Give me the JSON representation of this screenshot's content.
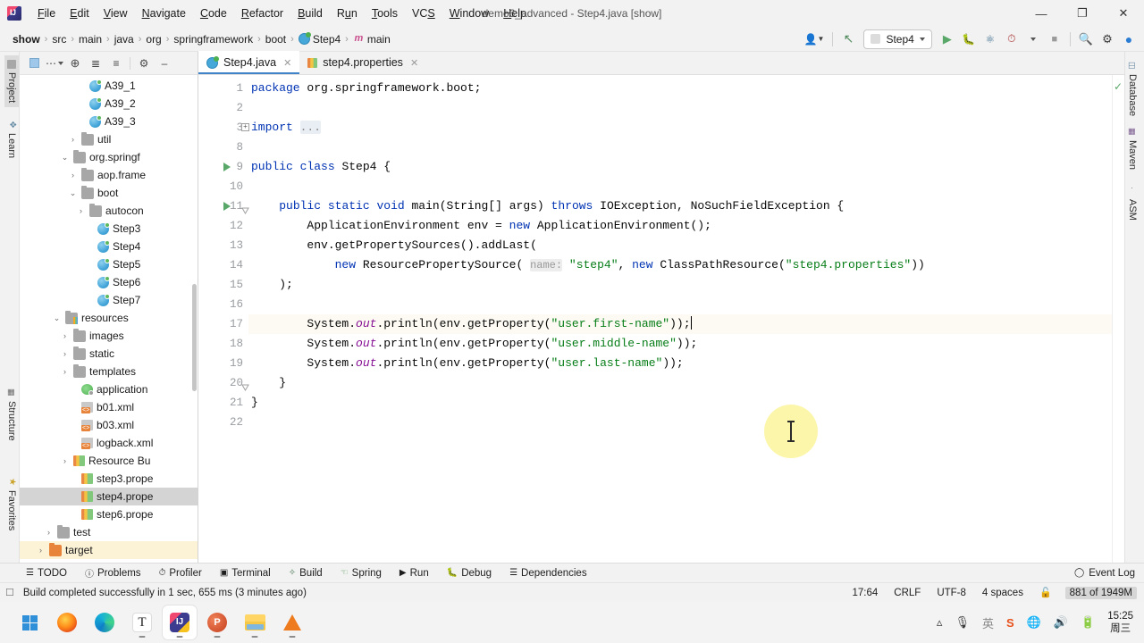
{
  "window": {
    "title": "demo6_advanced - Step4.java [show]",
    "app_icon": "intellij-idea-icon",
    "minimize": "—",
    "maximize": "❐",
    "close": "✕"
  },
  "menubar": {
    "items": [
      "File",
      "Edit",
      "View",
      "Navigate",
      "Code",
      "Refactor",
      "Build",
      "Run",
      "Tools",
      "VCS",
      "Window",
      "Help"
    ]
  },
  "breadcrumb": {
    "items": [
      {
        "label": "show",
        "icon": ""
      },
      {
        "label": "src",
        "icon": ""
      },
      {
        "label": "main",
        "icon": ""
      },
      {
        "label": "java",
        "icon": ""
      },
      {
        "label": "org",
        "icon": ""
      },
      {
        "label": "springframework",
        "icon": ""
      },
      {
        "label": "boot",
        "icon": ""
      },
      {
        "label": "Step4",
        "icon": "class-icon"
      },
      {
        "label": "main",
        "icon": "method-icon"
      }
    ],
    "separator": "›"
  },
  "toolbar": {
    "profile_label": "👤",
    "updates_label": "↖",
    "run_config": "Step4",
    "run_label": "▶",
    "debug_label": "debug-icon",
    "run_coverage_label": "run-with-coverage-icon",
    "profiler_label": "profiler-icon",
    "stop_label": "■",
    "search_label": "⌕",
    "settings_label": "⚙",
    "ai_label": "ai-assistant-icon"
  },
  "left_stripe": {
    "tabs": [
      {
        "label": "Project",
        "icon": "project-icon",
        "active": true
      },
      {
        "label": "Learn",
        "icon": "learn-icon",
        "active": false
      },
      {
        "label": "Structure",
        "icon": "structure-icon",
        "active": false
      },
      {
        "label": "Favorites",
        "icon": "star-icon",
        "active": false
      }
    ]
  },
  "right_stripe": {
    "tabs": [
      {
        "label": "Database",
        "icon": "database-icon"
      },
      {
        "label": "Maven",
        "icon": "maven-icon"
      },
      {
        "label": "ASM",
        "icon": "asm-icon"
      }
    ]
  },
  "project_panel": {
    "header_buttons": [
      {
        "name": "project-view-selector",
        "glyph": "▣"
      },
      {
        "name": "ellipsis",
        "glyph": "⋯"
      },
      {
        "name": "locate-icon",
        "glyph": "⊕"
      },
      {
        "name": "expand-all-icon",
        "glyph": "≣"
      },
      {
        "name": "collapse-all-icon",
        "glyph": "≡"
      },
      {
        "name": "gear-icon",
        "glyph": "⚙"
      },
      {
        "name": "hide-icon",
        "glyph": "—"
      }
    ],
    "tree": [
      {
        "label": "A39_1",
        "indent": 7,
        "icon": "class-icon",
        "arrow": "",
        "state": "normal"
      },
      {
        "label": "A39_2",
        "indent": 7,
        "icon": "class-icon",
        "arrow": "",
        "state": "normal"
      },
      {
        "label": "A39_3",
        "indent": 7,
        "icon": "class-icon",
        "arrow": "",
        "state": "normal"
      },
      {
        "label": "util",
        "indent": 6,
        "icon": "folder-gray",
        "arrow": "›",
        "state": "normal"
      },
      {
        "label": "org.springf",
        "indent": 5,
        "icon": "folder-gray",
        "arrow": "∨",
        "state": "normal"
      },
      {
        "label": "aop.frame",
        "indent": 6,
        "icon": "folder-gray",
        "arrow": "›",
        "state": "normal"
      },
      {
        "label": "boot",
        "indent": 6,
        "icon": "folder-gray",
        "arrow": "∨",
        "state": "normal"
      },
      {
        "label": "autocon",
        "indent": 7,
        "icon": "folder-gray",
        "arrow": "›",
        "state": "normal"
      },
      {
        "label": "Step3",
        "indent": 8,
        "icon": "class-icon",
        "arrow": "",
        "state": "normal"
      },
      {
        "label": "Step4",
        "indent": 8,
        "icon": "class-icon",
        "arrow": "",
        "state": "normal"
      },
      {
        "label": "Step5",
        "indent": 8,
        "icon": "class-icon",
        "arrow": "",
        "state": "normal"
      },
      {
        "label": "Step6",
        "indent": 8,
        "icon": "class-icon",
        "arrow": "",
        "state": "normal"
      },
      {
        "label": "Step7",
        "indent": 8,
        "icon": "class-icon",
        "arrow": "",
        "state": "normal"
      },
      {
        "label": "resources",
        "indent": 4,
        "icon": "folder-resources",
        "arrow": "∨",
        "state": "normal"
      },
      {
        "label": "images",
        "indent": 5,
        "icon": "folder-gray",
        "arrow": "›",
        "state": "normal"
      },
      {
        "label": "static",
        "indent": 5,
        "icon": "folder-gray",
        "arrow": "›",
        "state": "normal"
      },
      {
        "label": "templates",
        "indent": 5,
        "icon": "folder-gray",
        "arrow": "›",
        "state": "normal"
      },
      {
        "label": "application",
        "indent": 6,
        "icon": "yaml-icon",
        "arrow": "",
        "state": "normal"
      },
      {
        "label": "b01.xml",
        "indent": 6,
        "icon": "xml-icon",
        "arrow": "",
        "state": "normal"
      },
      {
        "label": "b03.xml",
        "indent": 6,
        "icon": "xml-icon",
        "arrow": "",
        "state": "normal"
      },
      {
        "label": "logback.xml",
        "indent": 6,
        "icon": "xml-icon",
        "arrow": "",
        "state": "normal"
      },
      {
        "label": "Resource Bu",
        "indent": 5,
        "icon": "properties-icon",
        "arrow": "›",
        "state": "normal"
      },
      {
        "label": "step3.prope",
        "indent": 6,
        "icon": "properties-icon",
        "arrow": "",
        "state": "normal"
      },
      {
        "label": "step4.prope",
        "indent": 6,
        "icon": "properties-icon",
        "arrow": "",
        "state": "selected"
      },
      {
        "label": "step6.prope",
        "indent": 6,
        "icon": "properties-icon",
        "arrow": "",
        "state": "normal"
      },
      {
        "label": "test",
        "indent": 3,
        "icon": "folder-gray",
        "arrow": "›",
        "state": "normal"
      },
      {
        "label": "target",
        "indent": 2,
        "icon": "folder-orange",
        "arrow": "›",
        "state": "target"
      }
    ]
  },
  "editor": {
    "tabs": [
      {
        "label": "Step4.java",
        "icon": "java-class-icon",
        "active": true,
        "close": "✕"
      },
      {
        "label": "step4.properties",
        "icon": "properties-icon",
        "active": false,
        "close": "✕"
      }
    ],
    "inspection_status": "✓",
    "lines": [
      {
        "num": "1",
        "run": false,
        "fold": "open",
        "hl": false
      },
      {
        "num": "2",
        "run": false,
        "fold": "",
        "hl": false
      },
      {
        "num": "3",
        "run": false,
        "fold": "box",
        "hl": false
      },
      {
        "num": "8",
        "run": false,
        "fold": "",
        "hl": false
      },
      {
        "num": "9",
        "run": true,
        "fold": "",
        "hl": false
      },
      {
        "num": "10",
        "run": false,
        "fold": "",
        "hl": false
      },
      {
        "num": "11",
        "run": true,
        "fold": "end",
        "hl": false
      },
      {
        "num": "12",
        "run": false,
        "fold": "",
        "hl": false
      },
      {
        "num": "13",
        "run": false,
        "fold": "",
        "hl": false
      },
      {
        "num": "14",
        "run": false,
        "fold": "",
        "hl": false
      },
      {
        "num": "15",
        "run": false,
        "fold": "",
        "hl": false
      },
      {
        "num": "16",
        "run": false,
        "fold": "",
        "hl": false
      },
      {
        "num": "17",
        "run": false,
        "fold": "",
        "hl": true
      },
      {
        "num": "18",
        "run": false,
        "fold": "",
        "hl": false
      },
      {
        "num": "19",
        "run": false,
        "fold": "",
        "hl": false
      },
      {
        "num": "20",
        "run": false,
        "fold": "end2",
        "hl": false
      },
      {
        "num": "21",
        "run": false,
        "fold": "",
        "hl": false
      },
      {
        "num": "22",
        "run": false,
        "fold": "",
        "hl": false
      }
    ],
    "code_text": [
      "package org.springframework.boot;",
      "",
      "import ...",
      "",
      "public class Step4 {",
      "",
      "    public static void main(String[] args) throws IOException, NoSuchFieldException {",
      "        ApplicationEnvironment env = new ApplicationEnvironment();",
      "        env.getPropertySources().addLast(",
      "            new ResourcePropertySource( name: \"step4\", new ClassPathResource(\"step4.properties\"))",
      "    );",
      "",
      "        System.out.println(env.getProperty(\"user.first-name\"));",
      "        System.out.println(env.getProperty(\"user.middle-name\"));",
      "        System.out.println(env.getProperty(\"user.last-name\"));",
      "    }",
      "}",
      ""
    ]
  },
  "bottom_tabs": [
    {
      "label": "TODO",
      "icon": "todo-icon"
    },
    {
      "label": "Problems",
      "icon": "problems-icon"
    },
    {
      "label": "Profiler",
      "icon": "profiler-icon"
    },
    {
      "label": "Terminal",
      "icon": "terminal-icon"
    },
    {
      "label": "Build",
      "icon": "build-icon"
    },
    {
      "label": "Spring",
      "icon": "spring-icon"
    },
    {
      "label": "Run",
      "icon": "run-icon"
    },
    {
      "label": "Debug",
      "icon": "debug-icon"
    },
    {
      "label": "Dependencies",
      "icon": "dependencies-icon"
    }
  ],
  "event_log": {
    "label": "Event Log",
    "icon": "event-log-icon"
  },
  "statusbar": {
    "message": "Build completed successfully in 1 sec, 655 ms (3 minutes ago)",
    "message_icon": "build-status-icon",
    "caret_position": "17:64",
    "line_separator": "CRLF",
    "encoding": "UTF-8",
    "indent": "4 spaces",
    "lock_icon": "🔓",
    "memory": "881 of 1949M"
  },
  "taskbar": {
    "apps": [
      {
        "name": "start-button",
        "label": "windows-logo-icon",
        "active": false,
        "running": false
      },
      {
        "name": "firefox",
        "label": "firefox-icon",
        "active": false,
        "running": false
      },
      {
        "name": "edge",
        "label": "edge-icon",
        "active": false,
        "running": false
      },
      {
        "name": "typora",
        "label": "typora-icon",
        "active": false,
        "running": true
      },
      {
        "name": "intellij-idea",
        "label": "intellij-idea-icon",
        "active": true,
        "running": true
      },
      {
        "name": "powerpoint",
        "label": "powerpoint-icon",
        "active": false,
        "running": true
      },
      {
        "name": "file-explorer",
        "label": "folder-icon",
        "active": false,
        "running": true
      },
      {
        "name": "vlc",
        "label": "vlc-icon",
        "active": false,
        "running": true
      }
    ],
    "tray": [
      "⌃",
      "🎙",
      "英",
      "S",
      "ἱ0",
      "🔊",
      "🔋"
    ],
    "clock_time": "15:25",
    "clock_date": "周三"
  },
  "colors": {
    "accent": "#4083c9",
    "run_green": "#59a869",
    "keyword": "#0033b3",
    "string": "#067d17",
    "selection": "#d4d4d4",
    "target_row": "#fcf3d7"
  }
}
